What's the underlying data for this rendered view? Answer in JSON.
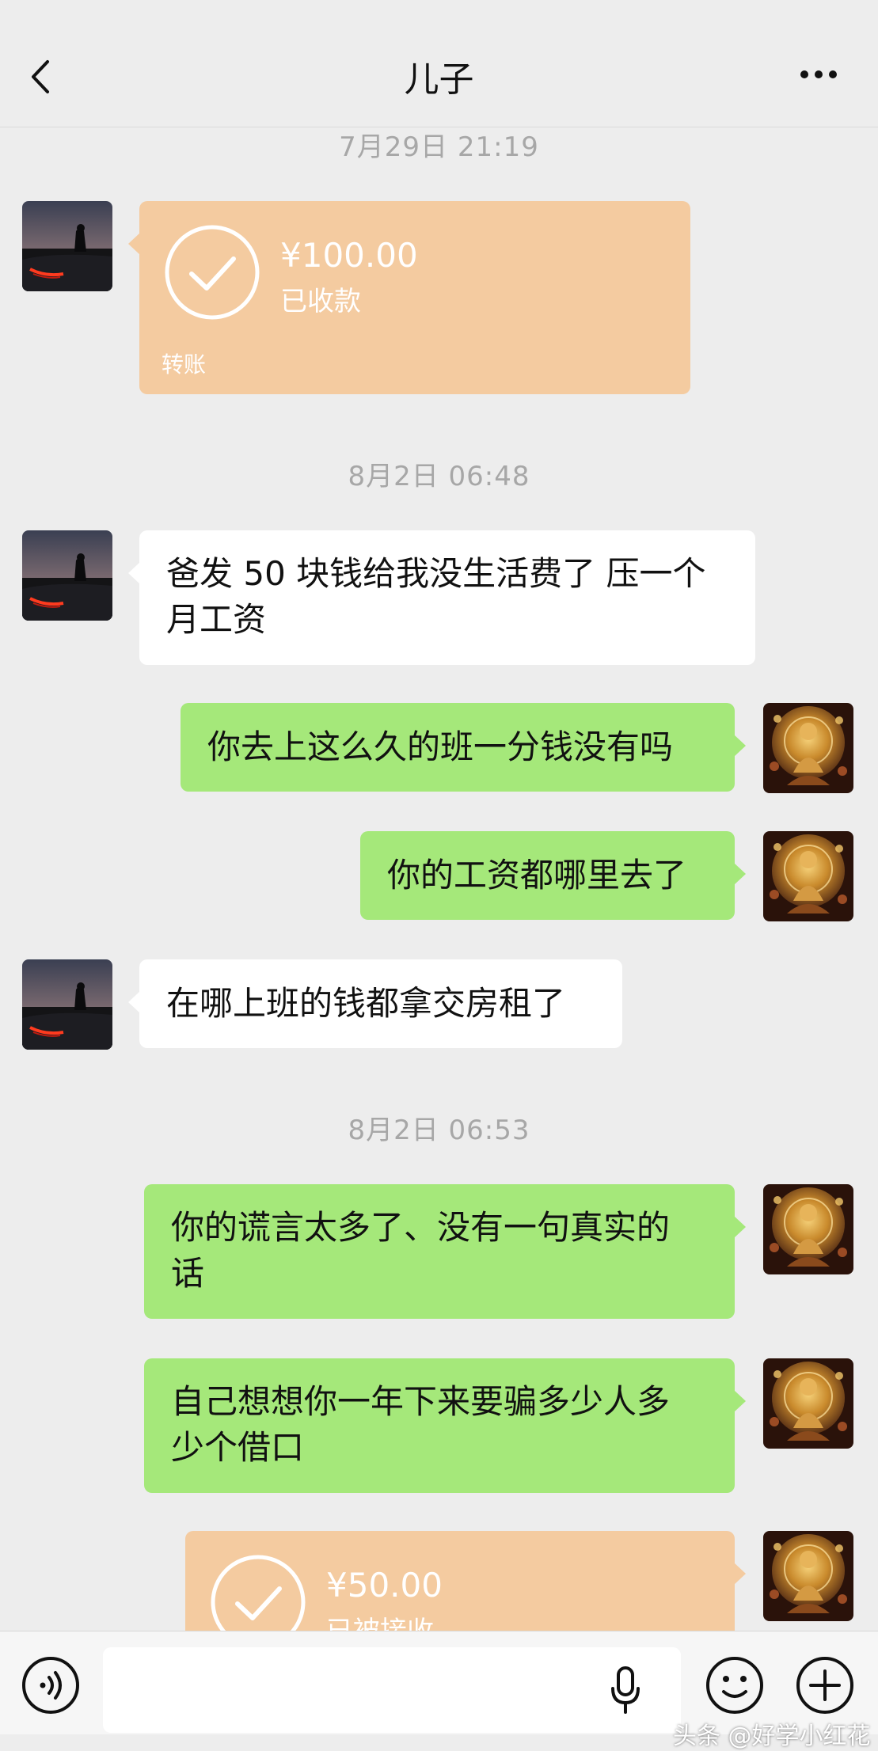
{
  "header": {
    "title": "儿子"
  },
  "timestamps": [
    "7月29日 21:19",
    "8月2日 06:48",
    "8月2日 06:53"
  ],
  "transfers": [
    {
      "amount": "¥100.00",
      "status": "已收款",
      "label": "转账"
    },
    {
      "amount": "¥50.00",
      "status": "已被接收"
    }
  ],
  "messages": [
    {
      "line1": "爸发 50 块钱给我没生活费了 压一个",
      "line2": "月工资"
    },
    {
      "line1": "你去上这么久的班一分钱没有吗"
    },
    {
      "line1": "你的工资都哪里去了"
    },
    {
      "line1": "在哪上班的钱都拿交房租了"
    },
    {
      "line1": "你的谎言太多了、没有一句真实的",
      "line2": "话"
    },
    {
      "line1": "自己想想你一年下来要骗多少人多",
      "line2": "少个借口"
    }
  ],
  "watermark": "头条 @好学小红花",
  "icons": [
    "back-icon",
    "more-icon",
    "voice-toggle-icon",
    "mic-icon",
    "emoji-icon",
    "plus-icon",
    "check-icon"
  ]
}
